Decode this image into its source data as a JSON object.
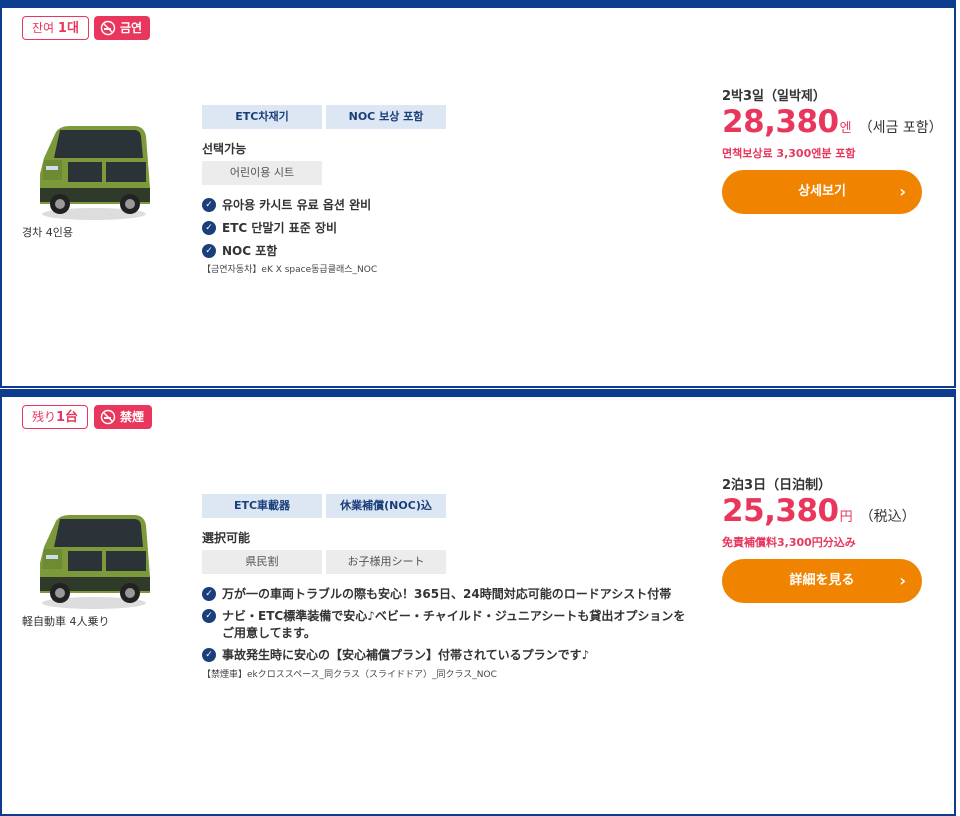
{
  "listings": [
    {
      "remaining_prefix": "잔여",
      "remaining_count": "1대",
      "smoking": "금연",
      "car_caption": "경차 4인용",
      "tags": [
        "ETC차재기",
        "NOC 보상 포함"
      ],
      "options_title": "선택가능",
      "options": [
        "어린이용 시트"
      ],
      "features": [
        "유아용 카시트 유료 옵션 완비",
        "ETC 단말기 표준 장비",
        "NOC 포함"
      ],
      "note": "【금연자동차】eK X space동급클래스_NOC",
      "nights": "2박3일（일박제）",
      "price": "28,380",
      "price_unit": "엔",
      "price_tax": "（세금 포함）",
      "insurance": "면책보상료 3,300엔분 포함",
      "button": "상세보기"
    },
    {
      "remaining_prefix": "残り",
      "remaining_count": "1台",
      "smoking": "禁煙",
      "car_caption": "軽自動車 4人乗り",
      "tags": [
        "ETC車載器",
        "休業補償(NOC)込"
      ],
      "options_title": "選択可能",
      "options": [
        "県民割",
        "お子様用シート"
      ],
      "features": [
        "万が一の車両トラブルの際も安心！365日、24時間対応可能のロードアシスト付帯",
        "ナビ・ETC標準装備で安心♪ベビー・チャイルド・ジュニアシートも貸出オプションをご用意してます。",
        "事故発生時に安心の【安心補償プラン】付帯されているプランです♪"
      ],
      "note": "【禁煙車】ekクロススペース_同クラス（スライドドア）_同クラス_NOC",
      "nights": "2泊3日（日泊制）",
      "price": "25,380",
      "price_unit": "円",
      "price_tax": "（税込）",
      "insurance": "免責補償料3,300円分込み",
      "button": "詳細を見る"
    }
  ],
  "icons": {
    "check": "check-circle-icon",
    "arrow": "chevron-right-icon",
    "no_smoking": "no-smoking-icon"
  },
  "colors": {
    "frame": "#0d3b8e",
    "accent_pink": "#e8365d",
    "button_orange": "#f08300",
    "tag_bg": "#dde7f4"
  }
}
